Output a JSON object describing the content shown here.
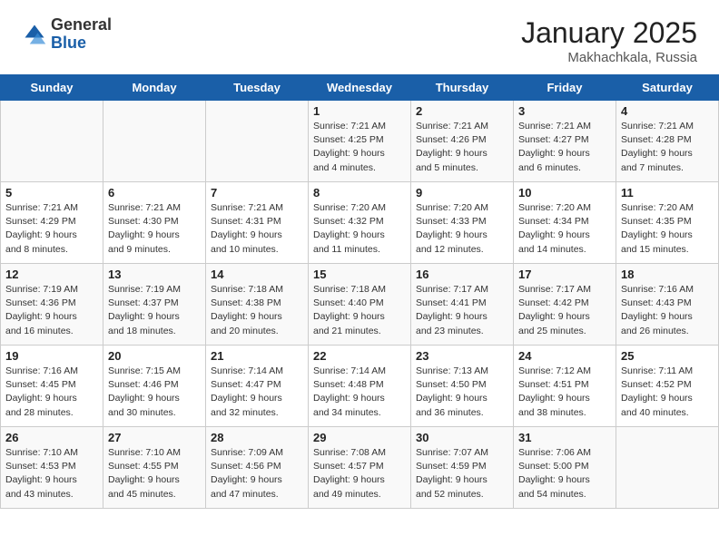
{
  "header": {
    "logo_general": "General",
    "logo_blue": "Blue",
    "month_year": "January 2025",
    "location": "Makhachkala, Russia"
  },
  "weekdays": [
    "Sunday",
    "Monday",
    "Tuesday",
    "Wednesday",
    "Thursday",
    "Friday",
    "Saturday"
  ],
  "weeks": [
    [
      {
        "day": "",
        "info": ""
      },
      {
        "day": "",
        "info": ""
      },
      {
        "day": "",
        "info": ""
      },
      {
        "day": "1",
        "info": "Sunrise: 7:21 AM\nSunset: 4:25 PM\nDaylight: 9 hours\nand 4 minutes."
      },
      {
        "day": "2",
        "info": "Sunrise: 7:21 AM\nSunset: 4:26 PM\nDaylight: 9 hours\nand 5 minutes."
      },
      {
        "day": "3",
        "info": "Sunrise: 7:21 AM\nSunset: 4:27 PM\nDaylight: 9 hours\nand 6 minutes."
      },
      {
        "day": "4",
        "info": "Sunrise: 7:21 AM\nSunset: 4:28 PM\nDaylight: 9 hours\nand 7 minutes."
      }
    ],
    [
      {
        "day": "5",
        "info": "Sunrise: 7:21 AM\nSunset: 4:29 PM\nDaylight: 9 hours\nand 8 minutes."
      },
      {
        "day": "6",
        "info": "Sunrise: 7:21 AM\nSunset: 4:30 PM\nDaylight: 9 hours\nand 9 minutes."
      },
      {
        "day": "7",
        "info": "Sunrise: 7:21 AM\nSunset: 4:31 PM\nDaylight: 9 hours\nand 10 minutes."
      },
      {
        "day": "8",
        "info": "Sunrise: 7:20 AM\nSunset: 4:32 PM\nDaylight: 9 hours\nand 11 minutes."
      },
      {
        "day": "9",
        "info": "Sunrise: 7:20 AM\nSunset: 4:33 PM\nDaylight: 9 hours\nand 12 minutes."
      },
      {
        "day": "10",
        "info": "Sunrise: 7:20 AM\nSunset: 4:34 PM\nDaylight: 9 hours\nand 14 minutes."
      },
      {
        "day": "11",
        "info": "Sunrise: 7:20 AM\nSunset: 4:35 PM\nDaylight: 9 hours\nand 15 minutes."
      }
    ],
    [
      {
        "day": "12",
        "info": "Sunrise: 7:19 AM\nSunset: 4:36 PM\nDaylight: 9 hours\nand 16 minutes."
      },
      {
        "day": "13",
        "info": "Sunrise: 7:19 AM\nSunset: 4:37 PM\nDaylight: 9 hours\nand 18 minutes."
      },
      {
        "day": "14",
        "info": "Sunrise: 7:18 AM\nSunset: 4:38 PM\nDaylight: 9 hours\nand 20 minutes."
      },
      {
        "day": "15",
        "info": "Sunrise: 7:18 AM\nSunset: 4:40 PM\nDaylight: 9 hours\nand 21 minutes."
      },
      {
        "day": "16",
        "info": "Sunrise: 7:17 AM\nSunset: 4:41 PM\nDaylight: 9 hours\nand 23 minutes."
      },
      {
        "day": "17",
        "info": "Sunrise: 7:17 AM\nSunset: 4:42 PM\nDaylight: 9 hours\nand 25 minutes."
      },
      {
        "day": "18",
        "info": "Sunrise: 7:16 AM\nSunset: 4:43 PM\nDaylight: 9 hours\nand 26 minutes."
      }
    ],
    [
      {
        "day": "19",
        "info": "Sunrise: 7:16 AM\nSunset: 4:45 PM\nDaylight: 9 hours\nand 28 minutes."
      },
      {
        "day": "20",
        "info": "Sunrise: 7:15 AM\nSunset: 4:46 PM\nDaylight: 9 hours\nand 30 minutes."
      },
      {
        "day": "21",
        "info": "Sunrise: 7:14 AM\nSunset: 4:47 PM\nDaylight: 9 hours\nand 32 minutes."
      },
      {
        "day": "22",
        "info": "Sunrise: 7:14 AM\nSunset: 4:48 PM\nDaylight: 9 hours\nand 34 minutes."
      },
      {
        "day": "23",
        "info": "Sunrise: 7:13 AM\nSunset: 4:50 PM\nDaylight: 9 hours\nand 36 minutes."
      },
      {
        "day": "24",
        "info": "Sunrise: 7:12 AM\nSunset: 4:51 PM\nDaylight: 9 hours\nand 38 minutes."
      },
      {
        "day": "25",
        "info": "Sunrise: 7:11 AM\nSunset: 4:52 PM\nDaylight: 9 hours\nand 40 minutes."
      }
    ],
    [
      {
        "day": "26",
        "info": "Sunrise: 7:10 AM\nSunset: 4:53 PM\nDaylight: 9 hours\nand 43 minutes."
      },
      {
        "day": "27",
        "info": "Sunrise: 7:10 AM\nSunset: 4:55 PM\nDaylight: 9 hours\nand 45 minutes."
      },
      {
        "day": "28",
        "info": "Sunrise: 7:09 AM\nSunset: 4:56 PM\nDaylight: 9 hours\nand 47 minutes."
      },
      {
        "day": "29",
        "info": "Sunrise: 7:08 AM\nSunset: 4:57 PM\nDaylight: 9 hours\nand 49 minutes."
      },
      {
        "day": "30",
        "info": "Sunrise: 7:07 AM\nSunset: 4:59 PM\nDaylight: 9 hours\nand 52 minutes."
      },
      {
        "day": "31",
        "info": "Sunrise: 7:06 AM\nSunset: 5:00 PM\nDaylight: 9 hours\nand 54 minutes."
      },
      {
        "day": "",
        "info": ""
      }
    ]
  ]
}
